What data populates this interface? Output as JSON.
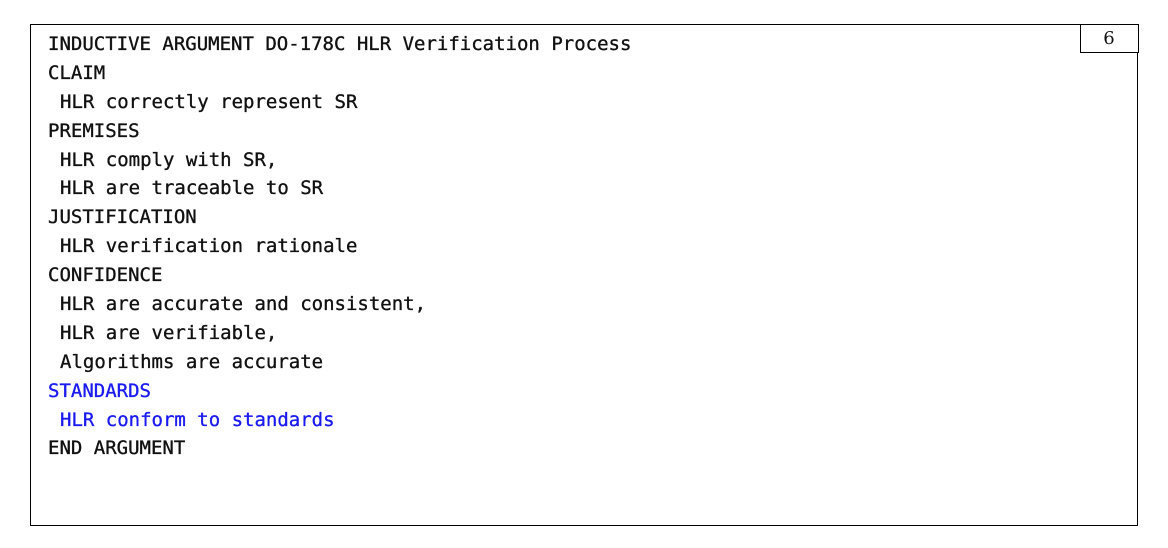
{
  "box_number": "6",
  "lines": [
    {
      "text": "INDUCTIVE ARGUMENT DO-178C HLR Verification Process",
      "indent": false,
      "color": "#111111"
    },
    {
      "text": "CLAIM",
      "indent": false,
      "color": "#111111"
    },
    {
      "text": "HLR correctly represent SR",
      "indent": true,
      "color": "#111111"
    },
    {
      "text": "PREMISES",
      "indent": false,
      "color": "#111111"
    },
    {
      "text": "HLR comply with SR,",
      "indent": true,
      "color": "#111111"
    },
    {
      "text": "HLR are traceable to SR",
      "indent": true,
      "color": "#111111"
    },
    {
      "text": "JUSTIFICATION",
      "indent": false,
      "color": "#111111"
    },
    {
      "text": "HLR verification rationale",
      "indent": true,
      "color": "#111111"
    },
    {
      "text": "CONFIDENCE",
      "indent": false,
      "color": "#111111"
    },
    {
      "text": "HLR are accurate and consistent,",
      "indent": true,
      "color": "#111111"
    },
    {
      "text": "HLR are verifiable,",
      "indent": true,
      "color": "#111111"
    },
    {
      "text": "Algorithms are accurate",
      "indent": true,
      "color": "#111111"
    },
    {
      "text": "STANDARDS",
      "indent": false,
      "color": "#1a1aee"
    },
    {
      "text": "HLR conform to standards",
      "indent": true,
      "color": "#1a1aee"
    },
    {
      "text": "END ARGUMENT",
      "indent": false,
      "color": "#111111"
    }
  ]
}
